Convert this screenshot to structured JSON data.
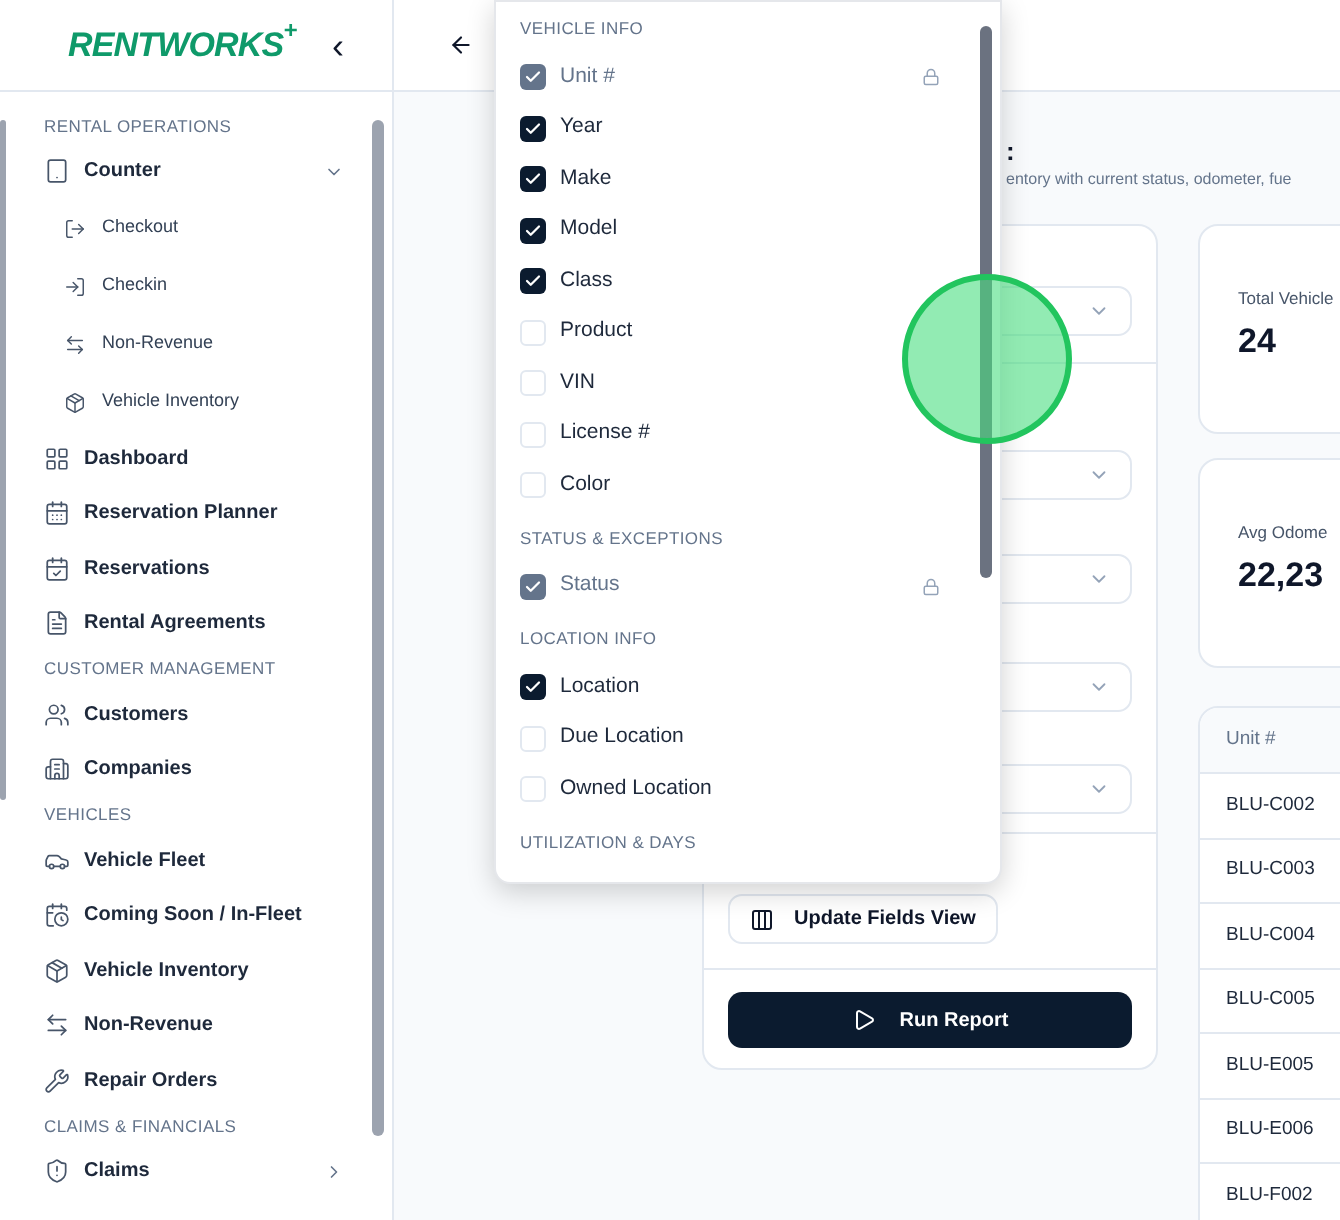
{
  "sidebar": {
    "logo": "RENTWORKS",
    "logo_mark": "+",
    "collapse": "‹",
    "sections": [
      {
        "title": "RENTAL OPERATIONS",
        "items": [
          {
            "label": "Counter",
            "expanded": true,
            "children": [
              {
                "label": "Checkout"
              },
              {
                "label": "Checkin"
              },
              {
                "label": "Non-Revenue"
              },
              {
                "label": "Vehicle Inventory"
              }
            ]
          },
          {
            "label": "Dashboard"
          },
          {
            "label": "Reservation Planner"
          },
          {
            "label": "Reservations"
          },
          {
            "label": "Rental Agreements"
          }
        ]
      },
      {
        "title": "CUSTOMER MANAGEMENT",
        "items": [
          {
            "label": "Customers"
          },
          {
            "label": "Companies"
          }
        ]
      },
      {
        "title": "VEHICLES",
        "items": [
          {
            "label": "Vehicle Fleet"
          },
          {
            "label": "Coming Soon / In-Fleet"
          },
          {
            "label": "Vehicle Inventory"
          },
          {
            "label": "Non-Revenue"
          },
          {
            "label": "Repair Orders"
          }
        ]
      },
      {
        "title": "CLAIMS & FINANCIALS",
        "items": [
          {
            "label": "Claims",
            "expanded": false
          }
        ]
      }
    ]
  },
  "page": {
    "title": ":",
    "subtitle": "entory with current status, odometer, fue"
  },
  "filters": {
    "update_button": "Update Fields View",
    "run_button": "Run Report"
  },
  "stats": [
    {
      "label": "Total Vehicle",
      "value": "24"
    },
    {
      "label": "Avg Odome",
      "value": "22,23"
    }
  ],
  "table": {
    "columns": [
      "Unit #"
    ],
    "rows": [
      "BLU-C002",
      "BLU-C003",
      "BLU-C004",
      "BLU-C005",
      "BLU-E005",
      "BLU-E006",
      "BLU-F002"
    ]
  },
  "fields_menu": {
    "groups": [
      {
        "title": "VEHICLE INFO",
        "fields": [
          {
            "label": "Unit #",
            "checked": true,
            "locked": true
          },
          {
            "label": "Year",
            "checked": true,
            "locked": false
          },
          {
            "label": "Make",
            "checked": true,
            "locked": false
          },
          {
            "label": "Model",
            "checked": true,
            "locked": false
          },
          {
            "label": "Class",
            "checked": true,
            "locked": false
          },
          {
            "label": "Product",
            "checked": false,
            "locked": false
          },
          {
            "label": "VIN",
            "checked": false,
            "locked": false
          },
          {
            "label": "License #",
            "checked": false,
            "locked": false
          },
          {
            "label": "Color",
            "checked": false,
            "locked": false
          }
        ]
      },
      {
        "title": "STATUS & EXCEPTIONS",
        "fields": [
          {
            "label": "Status",
            "checked": true,
            "locked": true
          }
        ]
      },
      {
        "title": "LOCATION INFO",
        "fields": [
          {
            "label": "Location",
            "checked": true,
            "locked": false
          },
          {
            "label": "Due Location",
            "checked": false,
            "locked": false
          },
          {
            "label": "Owned Location",
            "checked": false,
            "locked": false
          }
        ]
      },
      {
        "title": "UTILIZATION & DAYS"
      }
    ]
  }
}
